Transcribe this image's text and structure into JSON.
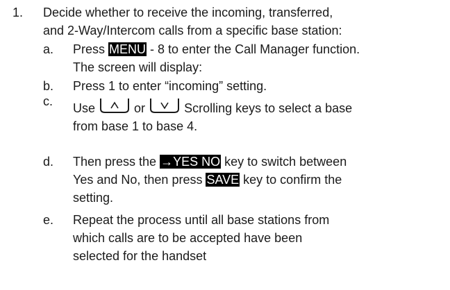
{
  "step": {
    "number": "1.",
    "text_line1": "Decide whether to receive the incoming, transferred,",
    "text_line2": "and 2-Way/Intercom calls from a specific base station:"
  },
  "substeps": {
    "a": {
      "label": "a.",
      "pre": "Press ",
      "key": "MENU",
      "post": " - 8 to enter the Call Manager function.",
      "line2": "The screen will display:"
    },
    "b": {
      "label": "b.",
      "text": "Press 1 to enter “incoming” setting."
    },
    "c": {
      "label": "c.",
      "pre": "Use ",
      "mid": "or ",
      "post": "Scrolling keys to select a base",
      "line2": "from base 1 to base 4."
    },
    "d": {
      "label": "d.",
      "pre": "Then press the ",
      "key_arrow": "→",
      "key": "YES NO",
      "post": " key to switch between",
      "line2_pre": "Yes and No, then press ",
      "line2_key": "SAVE",
      "line2_post": " key to confirm the",
      "line3": "setting."
    },
    "e": {
      "label": "e.",
      "line1": "Repeat the process until all base stations from",
      "line2": "which calls are to be accepted have been",
      "line3": "selected for the handset"
    }
  },
  "icons": {
    "up_key": "up-scroll-key-icon",
    "down_key": "down-scroll-key-icon"
  }
}
